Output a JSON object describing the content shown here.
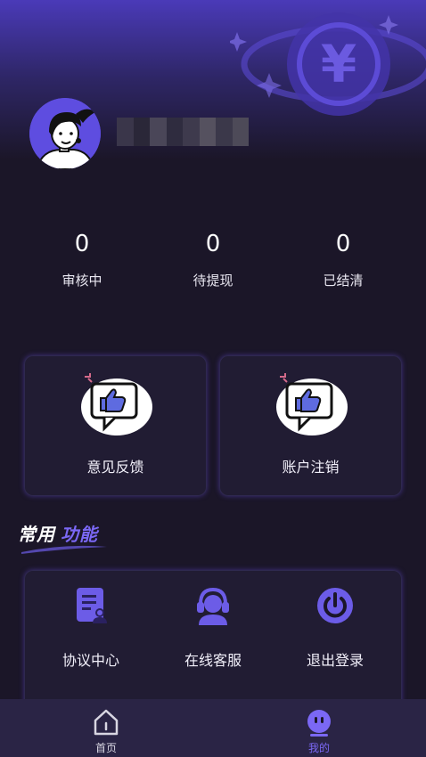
{
  "profile": {
    "avatar_icon": "girl-avatar"
  },
  "stats": [
    {
      "value": "0",
      "label": "审核中"
    },
    {
      "value": "0",
      "label": "待提现"
    },
    {
      "value": "0",
      "label": "已结清"
    }
  ],
  "cards": [
    {
      "label": "意见反馈",
      "icon": "thumbs-up-chat-icon"
    },
    {
      "label": "账户注销",
      "icon": "thumbs-up-chat-icon"
    }
  ],
  "section": {
    "title_part1": "常用",
    "title_part2": "功能"
  },
  "functions": [
    {
      "label": "协议中心",
      "icon": "document-user-icon"
    },
    {
      "label": "在线客服",
      "icon": "headset-agent-icon"
    },
    {
      "label": "退出登录",
      "icon": "power-icon"
    }
  ],
  "tabbar": [
    {
      "label": "首页",
      "icon": "home-icon"
    },
    {
      "label": "我的",
      "icon": "face-icon"
    }
  ],
  "colors": {
    "accent": "#6c5ce7",
    "background": "#1b1628",
    "tab_active": "#7b68f5",
    "tab_inactive": "#d8d6e2"
  }
}
